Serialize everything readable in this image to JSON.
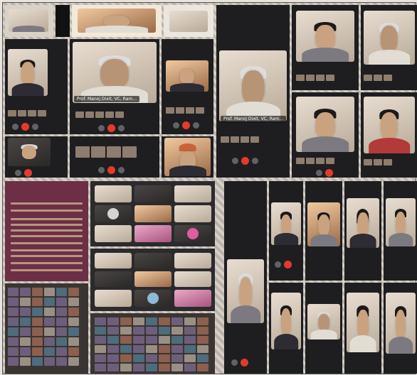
{
  "collage": {
    "description_labels": {
      "main_speaker_tag": "Prof. Manoj Dixit, VC, Ram...",
      "main_speaker_tag_2": "Prof. Manoj Dixit, VC, Ram..."
    }
  },
  "colors": {
    "meet_background": "#1e1e20",
    "end_call": "#e23b2e",
    "banner": "#6c2f45"
  }
}
